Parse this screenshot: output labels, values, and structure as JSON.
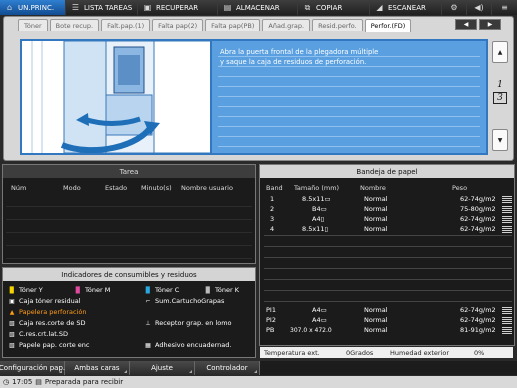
{
  "nav": {
    "items": [
      {
        "label": "UN.PRINC.",
        "icon": "home-icon",
        "active": true
      },
      {
        "label": "LISTA TAREAS",
        "icon": "list-icon",
        "active": false
      },
      {
        "label": "RECUPERAR",
        "icon": "recall-icon",
        "active": false
      },
      {
        "label": "ALMACENAR",
        "icon": "store-icon",
        "active": false
      },
      {
        "label": "COPIAR",
        "icon": "copy-icon",
        "active": false
      },
      {
        "label": "ESCANEAR",
        "icon": "scan-icon",
        "active": false
      }
    ]
  },
  "tabs": [
    {
      "label": "Tóner",
      "active": false
    },
    {
      "label": "Bote recup.",
      "active": false
    },
    {
      "label": "Falt.pap.(1)",
      "active": false
    },
    {
      "label": "Falta pap(2)",
      "active": false
    },
    {
      "label": "Falta pap(PB)",
      "active": false
    },
    {
      "label": "Añad.grap.",
      "active": false
    },
    {
      "label": "Resid.perfo.",
      "active": false
    },
    {
      "label": "Perfor.(FD)",
      "active": true
    }
  ],
  "guide": {
    "lines": [
      "Abra la puerta frontal de la plegadora múltiple",
      "y saque la caja de residuos de perforación.",
      "",
      "",
      "",
      "",
      "",
      "",
      "",
      ""
    ]
  },
  "pager": {
    "current": "1",
    "total": "3"
  },
  "job_panel": {
    "title": "Tarea",
    "columns": [
      "Núm",
      "Modo",
      "Estado",
      "Minuto(s)",
      "Nombre usuario"
    ]
  },
  "consumables": {
    "title": "Indicadores de consumibles y residuos",
    "items": [
      {
        "label": "Tóner Y",
        "warn": false
      },
      {
        "label": "Tóner M",
        "warn": false
      },
      {
        "label": "Tóner C",
        "warn": false
      },
      {
        "label": "Tóner K",
        "warn": false
      },
      {
        "label": "Caja tóner residual",
        "warn": false
      },
      {
        "label": "Sum.CartuchoGrapas",
        "warn": false
      },
      {
        "label": "Papelera perforación",
        "warn": true
      },
      {
        "label": "Caja res.corte de SD",
        "warn": false
      },
      {
        "label": "Receptor grap. en lomo",
        "warn": false
      },
      {
        "label": "C.res.crt.lat.SD",
        "warn": false
      },
      {
        "label": "Papele pap. corte enc",
        "warn": false
      },
      {
        "label": "Adhesivo encuadernad.",
        "warn": false
      }
    ]
  },
  "tray_panel": {
    "title": "Bandeja de papel",
    "columns": [
      "Band",
      "Tamaño (mm)",
      "Nombre",
      "Peso"
    ],
    "rows": [
      {
        "band": "1",
        "size": "8.5x11▭",
        "name": "Normal",
        "weight": "62-74g/m2"
      },
      {
        "band": "2",
        "size": "B4▭",
        "name": "Normal",
        "weight": "75-80g/m2"
      },
      {
        "band": "3",
        "size": "A4▯",
        "name": "Normal",
        "weight": "62-74g/m2"
      },
      {
        "band": "4",
        "size": "8.5x11▯",
        "name": "Normal",
        "weight": "62-74g/m2"
      }
    ],
    "bottom_rows": [
      {
        "band": "PI1",
        "size": "A4▭",
        "name": "Normal",
        "weight": "62-74g/m2"
      },
      {
        "band": "PI2",
        "size": "A4▭",
        "name": "Normal",
        "weight": "62-74g/m2"
      },
      {
        "band": "PB",
        "size": "307.0 x 472.0",
        "name": "Normal",
        "weight": "81-91g/m2"
      }
    ]
  },
  "env": {
    "temp_label": "Temperatura ext.",
    "temp_value": "0Grados",
    "hum_label": "Humedad exterior",
    "hum_value": "0%"
  },
  "bottom_buttons": [
    "Configuración pap.",
    "Ambas caras",
    "Ajuste",
    "Controlador"
  ],
  "statusline": {
    "time": "17:05",
    "text": "Preparada para recibir"
  }
}
